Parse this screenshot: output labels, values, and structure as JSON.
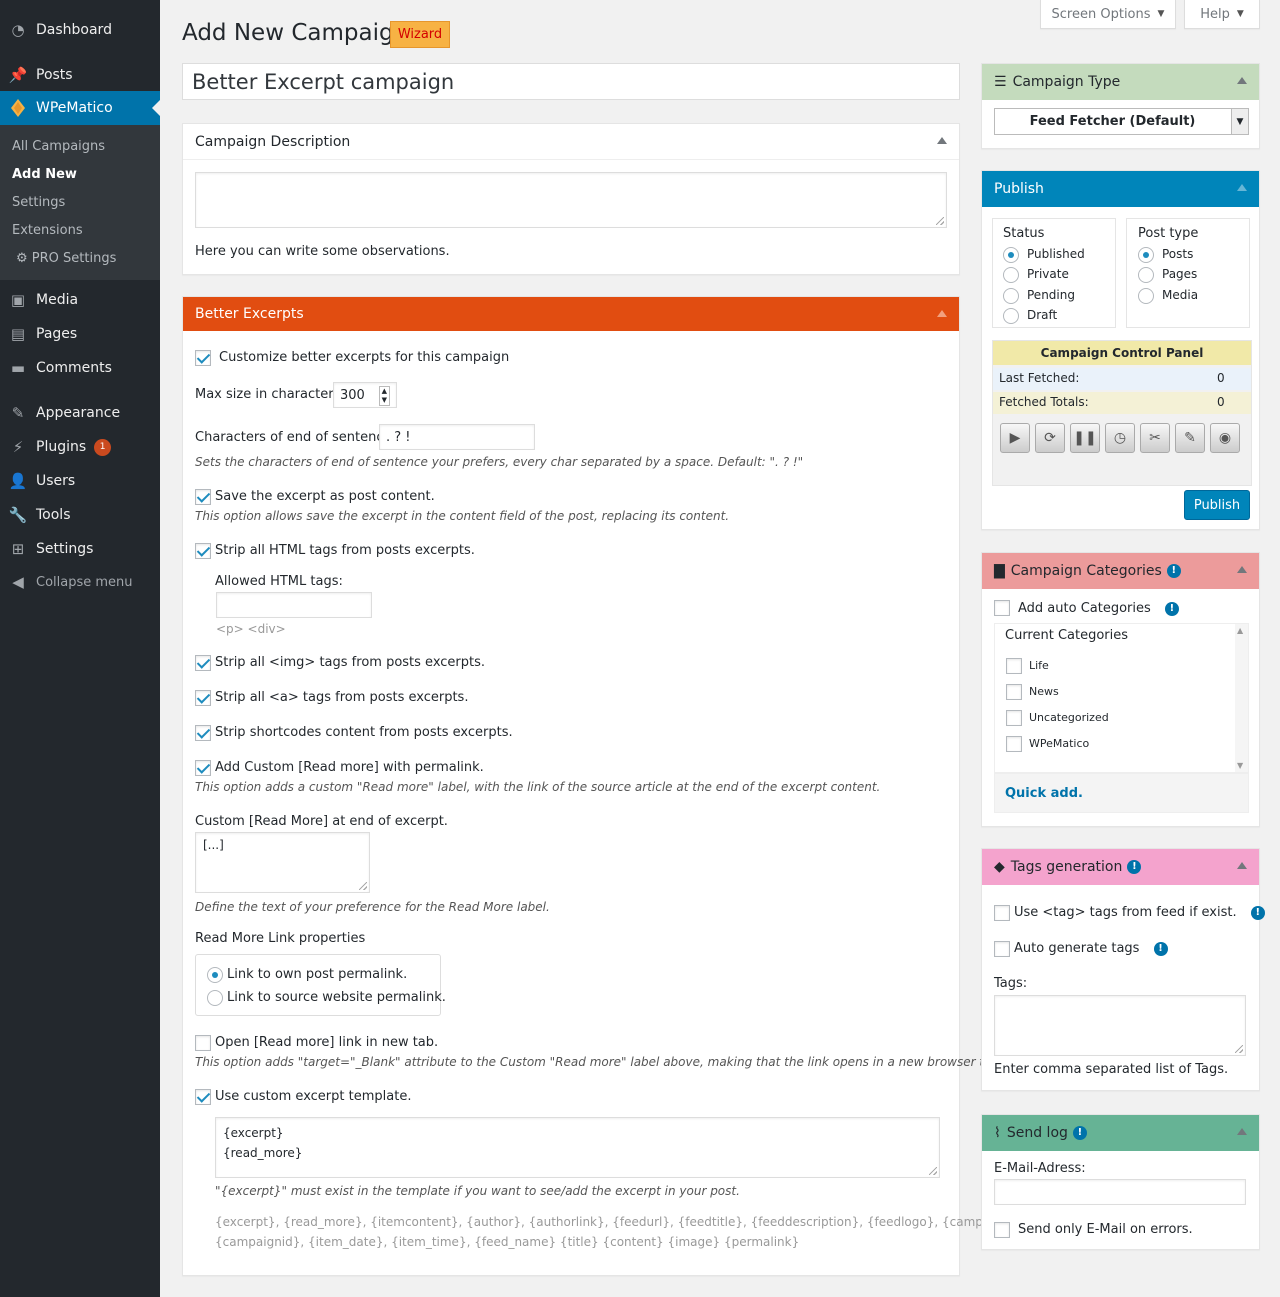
{
  "sidebar": {
    "items": [
      {
        "label": "Dashboard",
        "icon": "dashboard-icon"
      },
      {
        "label": "Posts",
        "icon": "pin-icon"
      },
      {
        "label": "WPeMatico",
        "icon": "wpematico-logo-icon"
      },
      {
        "label": "Media",
        "icon": "media-icon"
      },
      {
        "label": "Pages",
        "icon": "pages-icon"
      },
      {
        "label": "Comments",
        "icon": "comment-icon"
      },
      {
        "label": "Appearance",
        "icon": "brush-icon"
      },
      {
        "label": "Plugins",
        "icon": "plugin-icon",
        "badge": "1"
      },
      {
        "label": "Users",
        "icon": "user-icon"
      },
      {
        "label": "Tools",
        "icon": "wrench-icon"
      },
      {
        "label": "Settings",
        "icon": "settings-icon"
      }
    ],
    "submenu": [
      "All Campaigns",
      "Add New",
      "Settings",
      "Extensions",
      "PRO Settings"
    ],
    "collapse": "Collapse menu"
  },
  "top": {
    "screen_options": "Screen Options",
    "help": "Help"
  },
  "header": {
    "title": "Add New Campaign",
    "wizard": "Wizard"
  },
  "campaign_title": "Better Excerpt campaign",
  "description_box": {
    "title": "Campaign Description",
    "help": "Here you can write some observations."
  },
  "excerpts": {
    "title": "Better Excerpts",
    "customize": "Customize better excerpts for this campaign",
    "max_size_label": "Max size in characters:",
    "max_size_value": "300",
    "end_sentence_label": "Characters of end of sentence:",
    "end_sentence_value": ". ? !",
    "end_sentence_desc": "Sets the characters of end of sentence your prefers, every char separated by a space. Default: \". ? !\"",
    "save_content": "Save the excerpt as post content.",
    "save_content_desc": "This option allows save the excerpt in the content field of the post, replacing its content.",
    "strip_html": "Strip all HTML tags from posts excerpts.",
    "allowed_html_label": "Allowed HTML tags:",
    "allowed_html_hint": "<p> <div>",
    "strip_img": "Strip all <img> tags from posts excerpts.",
    "strip_a": "Strip all <a> tags from posts excerpts.",
    "strip_shortcodes": "Strip shortcodes content from posts excerpts.",
    "add_read_more": "Add Custom [Read more] with permalink.",
    "add_read_more_desc": "This option adds a custom \"Read more\" label, with the link of the source article at the end of the excerpt content.",
    "custom_read_more_label": "Custom [Read More] at end of excerpt.",
    "custom_read_more_value": "[...]",
    "custom_read_more_desc": "Define the text of your preference for the Read More label.",
    "link_props_label": "Read More Link properties",
    "link_own": "Link to own post permalink.",
    "link_source": "Link to source website permalink.",
    "new_tab": "Open [Read more] link in new tab.",
    "new_tab_desc": "This option adds \"target=\"_Blank\" attribute to the Custom \"Read more\" label above, making that the link opens in a new browser tab.",
    "use_template": "Use custom excerpt template.",
    "template_line1": "{excerpt}",
    "template_line2": "{read_more}",
    "template_note": "\"{excerpt}\" must exist in the template if you want to see/add the excerpt in your post.",
    "tags_line1": "{excerpt}, {read_more}, {itemcontent}, {author}, {authorlink}, {feedurl}, {feedtitle}, {feeddescription}, {feedlogo}, {campaigntitle},",
    "tags_line2": "{campaignid}, {item_date}, {item_time}, {feed_name} {title} {content} {image} {permalink}"
  },
  "campaign_type": {
    "title": "Campaign Type",
    "selected": "Feed Fetcher (Default)"
  },
  "publish": {
    "title": "Publish",
    "status_label": "Status",
    "status_options": [
      "Published",
      "Private",
      "Pending",
      "Draft"
    ],
    "post_type_label": "Post type",
    "post_type_options": [
      "Posts",
      "Pages",
      "Media"
    ],
    "control_panel_title": "Campaign Control Panel",
    "last_fetched_label": "Last Fetched:",
    "last_fetched_value": "0",
    "fetched_totals_label": "Fetched Totals:",
    "fetched_totals_value": "0",
    "button": "Publish"
  },
  "categories": {
    "title": "Campaign Categories",
    "auto": "Add auto Categories",
    "current": "Current Categories",
    "items": [
      "Life",
      "News",
      "Uncategorized",
      "WPeMatico"
    ],
    "quick_add": "Quick add."
  },
  "tags": {
    "title": "Tags generation",
    "use_feed_tags": "Use <tag> tags from feed if exist.",
    "auto_generate": "Auto generate tags",
    "tags_label": "Tags:",
    "help": "Enter comma separated list of Tags."
  },
  "send_log": {
    "title": "Send log",
    "email_label": "E-Mail-Adress:",
    "errors_only": "Send only E-Mail on errors."
  },
  "colors": {
    "sidebar_bg": "#23282d",
    "accent": "#0073aa",
    "excerpts_header": "#e14d11",
    "campaign_type_header": "#c4dbbd",
    "categories_header": "#ec9b9b",
    "tags_header": "#f4a3cd",
    "send_log_header": "#66b395",
    "control_panel_header": "#f1e9a8"
  }
}
